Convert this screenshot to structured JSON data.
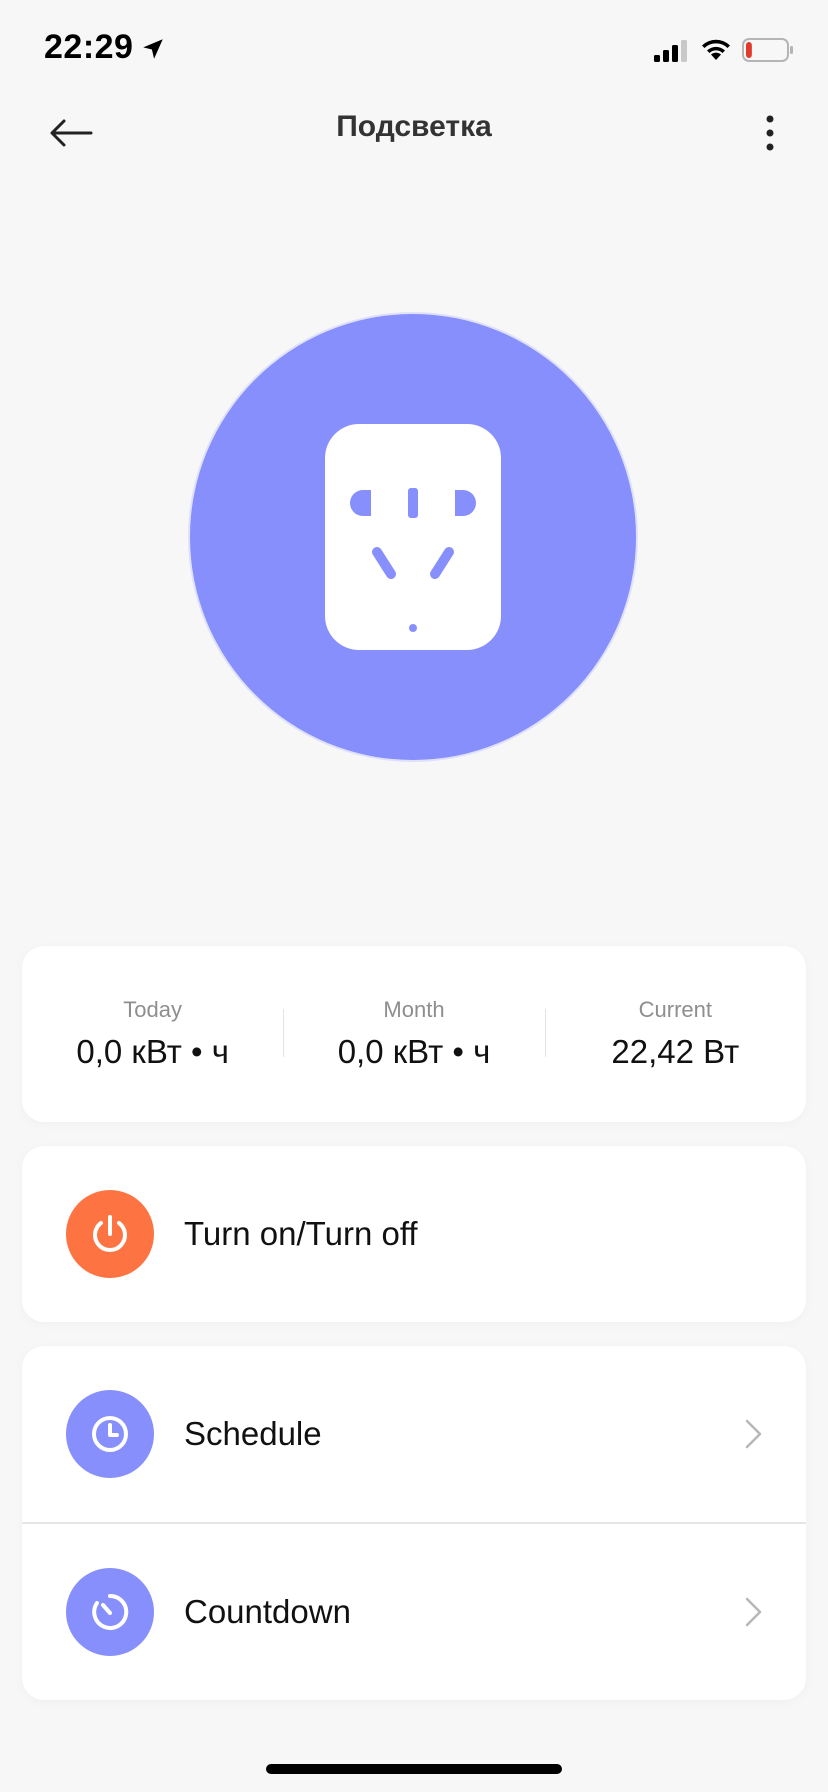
{
  "status_bar": {
    "time": "22:29",
    "battery_level": 0.15,
    "battery_color": "#e03a2d"
  },
  "nav": {
    "title": "Подсветка",
    "back_icon": "arrow-left-icon",
    "more_icon": "more-vertical-icon"
  },
  "device": {
    "icon": "socket-icon",
    "circle_color": "#868ffc"
  },
  "stats": [
    {
      "label": "Today",
      "value": "0,0 кВт • ч"
    },
    {
      "label": "Month",
      "value": "0,0 кВт • ч"
    },
    {
      "label": "Current",
      "value": "22,42 Вт"
    }
  ],
  "power": {
    "label": "Turn on/Turn off",
    "icon": "power-icon",
    "color": "#fd7442"
  },
  "menu": [
    {
      "label": "Schedule",
      "icon": "clock-icon",
      "color": "#868ffc"
    },
    {
      "label": "Countdown",
      "icon": "timer-icon",
      "color": "#868ffc"
    }
  ]
}
